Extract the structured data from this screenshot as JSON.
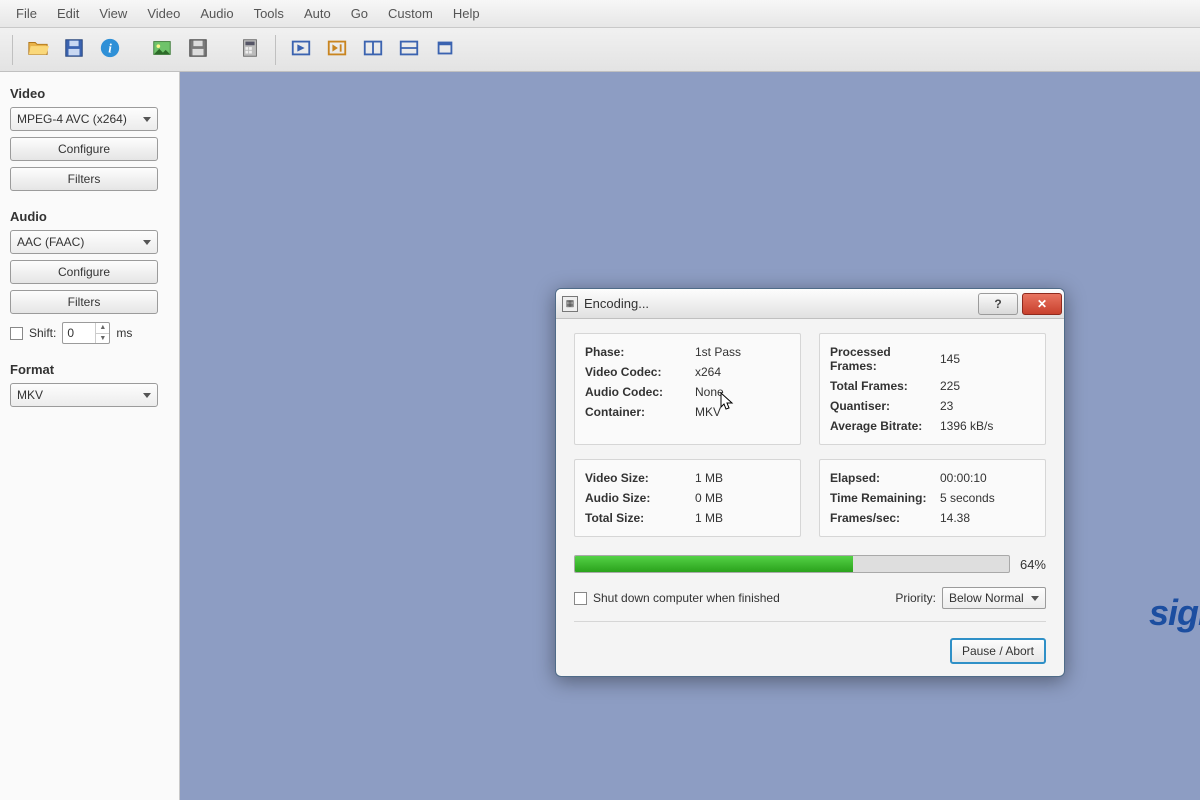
{
  "menu": {
    "items": [
      "File",
      "Edit",
      "View",
      "Video",
      "Audio",
      "Tools",
      "Auto",
      "Go",
      "Custom",
      "Help"
    ]
  },
  "toolbar": {
    "icons": [
      "open",
      "save",
      "info",
      "picture",
      "save-image",
      "calculator",
      "play-marker",
      "next-marker",
      "split",
      "rows",
      "window"
    ]
  },
  "sidebar": {
    "video_label": "Video",
    "video_codec": "MPEG-4 AVC (x264)",
    "configure": "Configure",
    "filters": "Filters",
    "audio_label": "Audio",
    "audio_codec": "AAC (FAAC)",
    "shift_label": "Shift:",
    "shift_value": "0",
    "shift_unit": "ms",
    "format_label": "Format",
    "format_value": "MKV"
  },
  "watermark": "sight",
  "dialog": {
    "title": "Encoding...",
    "left1": {
      "phase_l": "Phase:",
      "phase_v": "1st Pass",
      "vc_l": "Video Codec:",
      "vc_v": "x264",
      "ac_l": "Audio Codec:",
      "ac_v": "None",
      "ct_l": "Container:",
      "ct_v": "MKV"
    },
    "right1": {
      "pf_l": "Processed Frames:",
      "pf_v": "145",
      "tf_l": "Total Frames:",
      "tf_v": "225",
      "qt_l": "Quantiser:",
      "qt_v": "23",
      "ab_l": "Average Bitrate:",
      "ab_v": "1396 kB/s"
    },
    "left2": {
      "vs_l": "Video Size:",
      "vs_v": "1 MB",
      "as_l": "Audio Size:",
      "as_v": "0 MB",
      "ts_l": "Total Size:",
      "ts_v": "1 MB"
    },
    "right2": {
      "el_l": "Elapsed:",
      "el_v": "00:00:10",
      "tr_l": "Time Remaining:",
      "tr_v": "5 seconds",
      "fs_l": "Frames/sec:",
      "fs_v": "14.38"
    },
    "progress_pct": "64%",
    "progress_value": 64,
    "shutdown_label": "Shut down computer when finished",
    "priority_label": "Priority:",
    "priority_value": "Below Normal",
    "pause_label": "Pause / Abort"
  }
}
